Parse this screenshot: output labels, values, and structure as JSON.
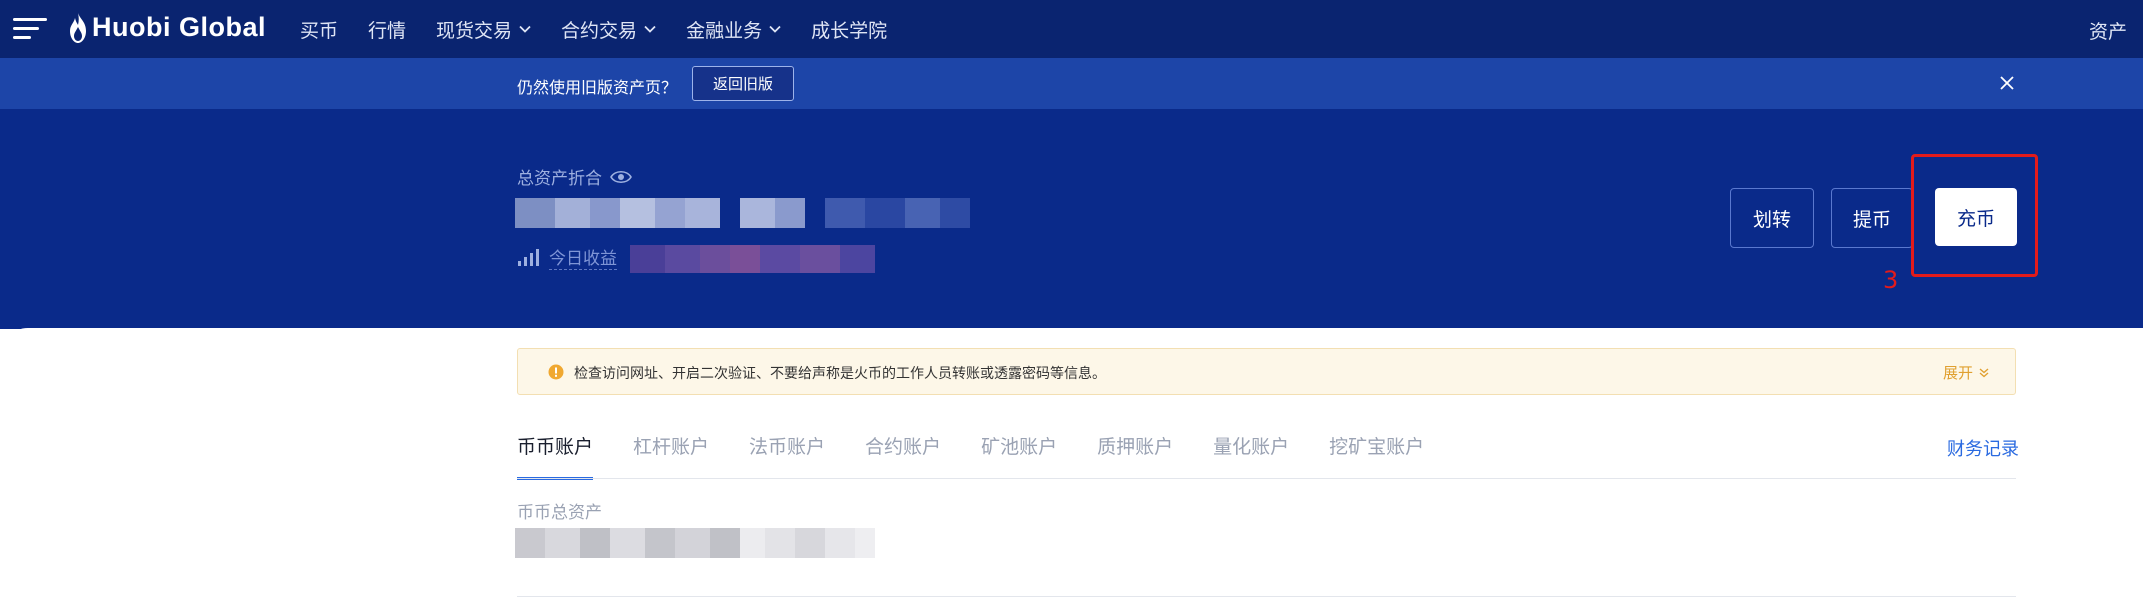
{
  "topnav": {
    "logo_text": "Huobi Global",
    "items": [
      {
        "label": "买币",
        "has_dropdown": false
      },
      {
        "label": "行情",
        "has_dropdown": false
      },
      {
        "label": "现货交易",
        "has_dropdown": true
      },
      {
        "label": "合约交易",
        "has_dropdown": true
      },
      {
        "label": "金融业务",
        "has_dropdown": true
      },
      {
        "label": "成长学院",
        "has_dropdown": false
      }
    ],
    "assets_label": "资产"
  },
  "banner": {
    "text": "仍然使用旧版资产页？",
    "button_label": "返回旧版"
  },
  "hero": {
    "total_label": "总资产折合",
    "today_label": "今日收益",
    "buttons": {
      "transfer": "划转",
      "withdraw": "提币",
      "deposit": "充币"
    },
    "annotation_number": "3"
  },
  "notice": {
    "text": "检查访问网址、开启二次验证、不要给声称是火币的工作人员转账或透露密码等信息。",
    "expand_label": "展开"
  },
  "tabs": [
    {
      "label": "币币账户",
      "active": true
    },
    {
      "label": "杠杆账户",
      "active": false
    },
    {
      "label": "法币账户",
      "active": false
    },
    {
      "label": "合约账户",
      "active": false
    },
    {
      "label": "矿池账户",
      "active": false
    },
    {
      "label": "质押账户",
      "active": false
    },
    {
      "label": "量化账户",
      "active": false
    },
    {
      "label": "挖矿宝账户",
      "active": false
    }
  ],
  "finance_records_label": "财务记录",
  "account_section": {
    "total_label": "币币总资产"
  },
  "colors": {
    "nav_bg": "#0a2470",
    "banner_bg": "#1d45a8",
    "hero_bg": "#0a2a8a",
    "accent": "#2a6ae0",
    "highlight": "#e31b1b",
    "notice_bg": "#fdf7e8",
    "notice_accent": "#e0a030"
  }
}
